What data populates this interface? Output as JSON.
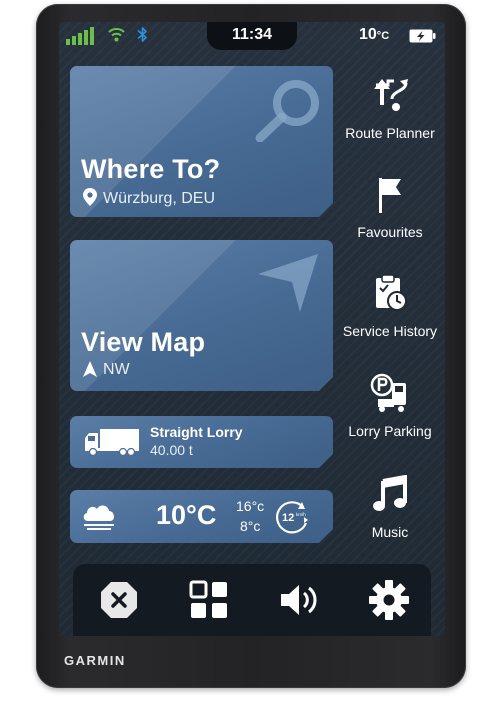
{
  "status": {
    "time": "11:34",
    "temperature": "10",
    "temperature_unit": "°C",
    "signal_color": "#6cc04a",
    "wifi_color": "#6cc04a",
    "bluetooth_color": "#2f8fd8"
  },
  "cards": {
    "where_to": {
      "title": "Where To?",
      "location": "Würzburg, DEU",
      "icon": "search-icon"
    },
    "view_map": {
      "title": "View Map",
      "heading": "NW",
      "icon": "navigation-arrow-icon"
    },
    "vehicle": {
      "name": "Straight Lorry",
      "weight": "40.00 t",
      "icon": "lorry-icon"
    },
    "weather": {
      "temp": "10°C",
      "high": "16°c",
      "low": "8°c",
      "speed": "12",
      "speed_unit": "km/h",
      "icon": "cloud-icon"
    }
  },
  "side_menu": [
    {
      "label": "Route Planner",
      "icon": "route-planner-icon"
    },
    {
      "label": "Favourites",
      "icon": "flag-icon"
    },
    {
      "label": "Service History",
      "icon": "clipboard-clock-icon"
    },
    {
      "label": "Lorry Parking",
      "icon": "lorry-parking-icon"
    },
    {
      "label": "Music",
      "icon": "music-note-icon"
    }
  ],
  "dock": [
    {
      "name": "close",
      "icon": "close-icon"
    },
    {
      "name": "apps",
      "icon": "apps-grid-icon"
    },
    {
      "name": "volume",
      "icon": "volume-icon"
    },
    {
      "name": "settings",
      "icon": "gear-icon"
    }
  ],
  "brand": "GARMIN"
}
